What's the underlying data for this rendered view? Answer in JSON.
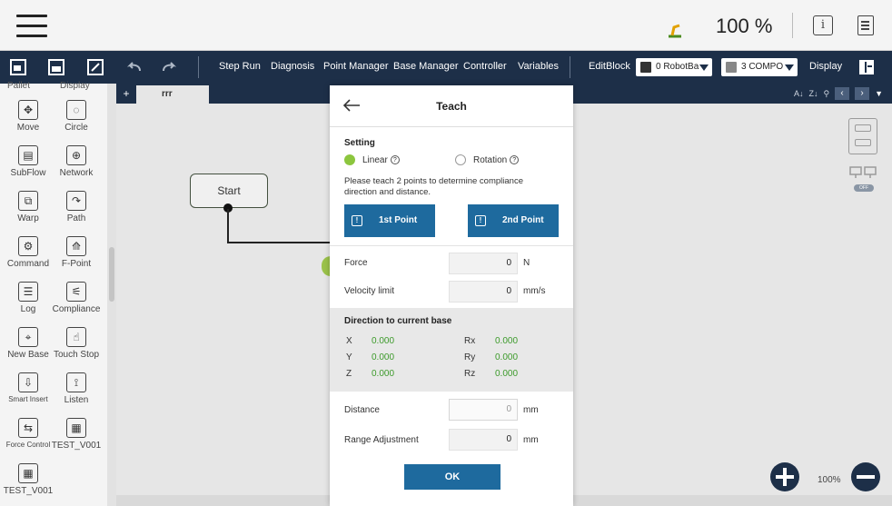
{
  "status_bar": {
    "speed": "100 %",
    "info_glyph": "i"
  },
  "toolbar": {
    "items": [
      "Step Run",
      "Diagnosis",
      "Point Manager",
      "Base Manager",
      "Controller",
      "Variables"
    ],
    "editblock": "EditBlock",
    "robot_base_dropdown": "0 RobotBa",
    "tool_dropdown": "3 COMPO",
    "display": "Display"
  },
  "node_panel": {
    "cutoff_top": [
      "Pallet",
      "Display"
    ],
    "nodes": [
      {
        "label": "Move",
        "icon": "move-icon",
        "glyph": "✥"
      },
      {
        "label": "Circle",
        "icon": "circle-icon",
        "glyph": "◌"
      },
      {
        "label": "SubFlow",
        "icon": "subflow-icon",
        "glyph": "▤"
      },
      {
        "label": "Network",
        "icon": "network-icon",
        "glyph": "⊕"
      },
      {
        "label": "Warp",
        "icon": "warp-icon",
        "glyph": "⧉"
      },
      {
        "label": "Path",
        "icon": "path-icon",
        "glyph": "↷"
      },
      {
        "label": "Command",
        "icon": "command-icon",
        "glyph": "⚙"
      },
      {
        "label": "F-Point",
        "icon": "fpoint-icon",
        "glyph": "⟰"
      },
      {
        "label": "Log",
        "icon": "log-icon",
        "glyph": "☰"
      },
      {
        "label": "Compliance",
        "icon": "compliance-icon",
        "glyph": "⚟"
      },
      {
        "label": "New Base",
        "icon": "newbase-icon",
        "glyph": "⌖"
      },
      {
        "label": "Touch Stop",
        "icon": "touchstop-icon",
        "glyph": "☝"
      },
      {
        "label": "Smart Insert",
        "icon": "smartinsert-icon",
        "glyph": "⇩"
      },
      {
        "label": "Listen",
        "icon": "listen-icon",
        "glyph": "⟟"
      },
      {
        "label": "Force Control",
        "icon": "forcecontrol-icon",
        "glyph": "⇆"
      },
      {
        "label": "TEST_V001",
        "icon": "test-icon",
        "glyph": "▦"
      },
      {
        "label": "TEST_V001",
        "icon": "test-icon",
        "glyph": "▦"
      }
    ]
  },
  "canvas": {
    "tab_add": "+",
    "tab_label": "rrr",
    "start_node": "Start",
    "zoom_label": "100%",
    "off_badge": "OFF"
  },
  "teach_dialog": {
    "title": "Teach",
    "setting_title": "Setting",
    "mode_linear": "Linear",
    "mode_rotation": "Rotation",
    "selected_mode": "Linear",
    "help_glyph": "?",
    "hint": "Please teach 2 points to determine compliance direction and distance.",
    "point_icon_glyph": "!",
    "point1": "1st Point",
    "point2": "2nd Point",
    "force_label": "Force",
    "force_value": "0",
    "force_unit": "N",
    "velocity_label": "Velocity limit",
    "velocity_value": "0",
    "velocity_unit": "mm/s",
    "direction_title": "Direction to current base",
    "direction": {
      "X": "0.000",
      "Y": "0.000",
      "Z": "0.000",
      "Rx": "0.000",
      "Ry": "0.000",
      "Rz": "0.000"
    },
    "axis_labels": {
      "x": "X",
      "y": "Y",
      "z": "Z",
      "rx": "Rx",
      "ry": "Ry",
      "rz": "Rz"
    },
    "distance_label": "Distance",
    "distance_value": "0",
    "distance_unit": "mm",
    "range_label": "Range Adjustment",
    "range_value": "0",
    "range_unit": "mm",
    "ok": "OK"
  },
  "colors": {
    "toolbar_bg": "#1d2f48",
    "accent_blue": "#1e6a9e",
    "radio_green": "#8cc63e",
    "value_green": "#3c9a2a"
  }
}
